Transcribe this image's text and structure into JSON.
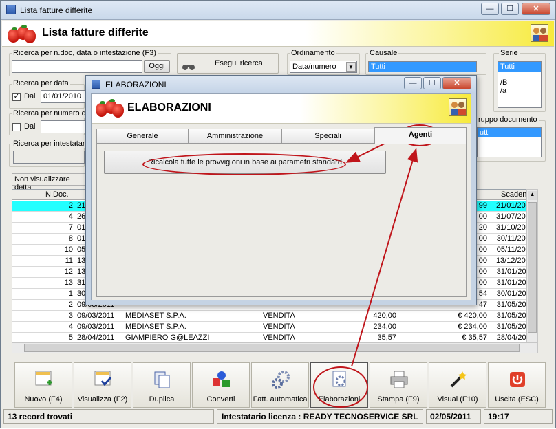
{
  "window": {
    "title": "Lista fatture differite",
    "min": "—",
    "max": "☐",
    "close": "✕"
  },
  "header": {
    "title": "Lista fatture differite"
  },
  "search": {
    "legend": "Ricerca per n.doc, data o intestazione (F3)",
    "value": "",
    "oggi": "Oggi",
    "run_label": "Esegui ricerca",
    "date_legend": "Ricerca per data",
    "dal": "Dal",
    "date_value": "01/01/2010",
    "number_legend": "Ricerca per numero d",
    "number_dal": "Dal",
    "holder_legend": "Ricerca per intestatari",
    "hide_label": "Non visualizzare detta"
  },
  "ordinamento": {
    "legend": "Ordinamento",
    "value": "Data/numero"
  },
  "causale": {
    "legend": "Causale",
    "items": [
      "Tutti"
    ]
  },
  "serie": {
    "legend": "Serie",
    "items": [
      "Tutti",
      "",
      "/B",
      "/a"
    ]
  },
  "gruppo": {
    "legend": "ruppo documento",
    "items": [
      "utti"
    ]
  },
  "grid": {
    "headers": {
      "ndoc": "N.Doc.",
      "scadenze": "Scadenze"
    },
    "rows": [
      {
        "n": "2",
        "date": "21",
        "name": "",
        "tipo": "",
        "imp": "",
        "tot": "99",
        "scad": "21/01/2010"
      },
      {
        "n": "4",
        "date": "26",
        "name": "",
        "tipo": "",
        "imp": "",
        "tot": "00",
        "scad": "31/07/2010"
      },
      {
        "n": "7",
        "date": "01",
        "name": "",
        "tipo": "",
        "imp": "",
        "tot": "20",
        "scad": "31/10/2010"
      },
      {
        "n": "8",
        "date": "01",
        "name": "",
        "tipo": "",
        "imp": "",
        "tot": "00",
        "scad": "30/11/2010"
      },
      {
        "n": "10",
        "date": "05",
        "name": "",
        "tipo": "",
        "imp": "",
        "tot": "00",
        "scad": "05/11/2010"
      },
      {
        "n": "11",
        "date": "13",
        "name": "",
        "tipo": "",
        "imp": "",
        "tot": "00",
        "scad": "13/12/2010"
      },
      {
        "n": "12",
        "date": "13",
        "name": "",
        "tipo": "",
        "imp": "",
        "tot": "00",
        "scad": "31/01/2011"
      },
      {
        "n": "13",
        "date": "31",
        "name": "",
        "tipo": "",
        "imp": "",
        "tot": "00",
        "scad": "31/01/2011"
      },
      {
        "n": "1",
        "date": "30",
        "name": "",
        "tipo": "",
        "imp": "",
        "tot": "54",
        "scad": "30/01/2011"
      },
      {
        "n": "2",
        "date": "09/03/2011",
        "name": "",
        "tipo": "",
        "imp": "",
        "tot": "47",
        "scad": "31/05/2011"
      },
      {
        "n": "3",
        "date": "09/03/2011",
        "name": "MEDIASET S.P.A.",
        "tipo": "VENDITA",
        "imp": "420,00",
        "tot": "€ 420,00",
        "scad": "31/05/2011"
      },
      {
        "n": "4",
        "date": "09/03/2011",
        "name": "MEDIASET S.P.A.",
        "tipo": "VENDITA",
        "imp": "234,00",
        "tot": "€ 234,00",
        "scad": "31/05/2011"
      },
      {
        "n": "5",
        "date": "28/04/2011",
        "name": "GIAMPIERO G@LEAZZI",
        "tipo": "VENDITA",
        "imp": "35,57",
        "tot": "€ 35,57",
        "scad": "28/04/2011"
      }
    ]
  },
  "toolbar": {
    "buttons": [
      "Nuovo (F4)",
      "Visualizza (F2)",
      "Duplica",
      "Converti",
      "Fatt. automatica",
      "Elaborazioni",
      "Stampa (F9)",
      "Visual (F10)",
      "Uscita (ESC)"
    ]
  },
  "status": {
    "records": "13 record trovati",
    "license": "Intestatario licenza : READY TECNOSERVICE SRL",
    "date": "02/05/2011",
    "time": "19:17"
  },
  "dialog": {
    "title": "ELABORAZIONI",
    "header": "ELABORAZIONI",
    "tabs": [
      "Generale",
      "Amministrazione",
      "Speciali",
      "Agenti"
    ],
    "action": "Ricalcola tutte le provvigioni in base ai parametri standard"
  },
  "colors": {
    "accent": "#c0151b",
    "selection": "#3399ff",
    "highlight_row": "#22ffff"
  }
}
